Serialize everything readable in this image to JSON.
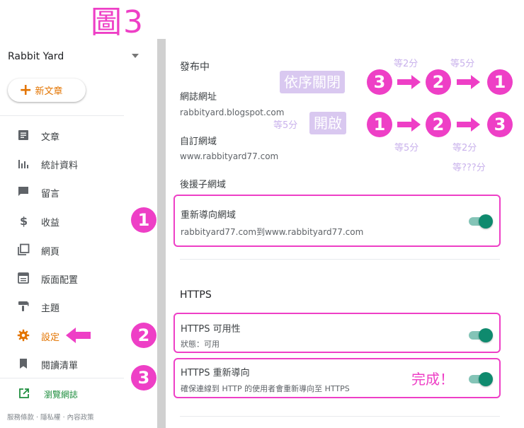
{
  "figure_title": "圖3",
  "sidebar": {
    "blog_name": "Rabbit Yard",
    "new_post_label": "新文章",
    "items": [
      {
        "label": "文章",
        "icon": "post-icon"
      },
      {
        "label": "統計資料",
        "icon": "stats-icon"
      },
      {
        "label": "留言",
        "icon": "comment-icon"
      },
      {
        "label": "收益",
        "icon": "dollar-icon"
      },
      {
        "label": "網頁",
        "icon": "pages-icon"
      },
      {
        "label": "版面配置",
        "icon": "layout-icon"
      },
      {
        "label": "主題",
        "icon": "theme-icon"
      },
      {
        "label": "設定",
        "icon": "gear-icon"
      },
      {
        "label": "閱讀清單",
        "icon": "bookmark-icon"
      }
    ],
    "view_blog_label": "瀏覽網誌",
    "footer_links": "服務條款 · 隱私權 · 內容政策"
  },
  "main": {
    "publishing_heading": "發布中",
    "blog_address_label": "網誌網址",
    "blog_address_value": "rabbityard.blogspot.com",
    "custom_domain_label": "自訂網域",
    "custom_domain_value": "www.rabbityard77.com",
    "fallback_domain_label": "後援子網域",
    "redirect_domain": {
      "label": "重新導向網域",
      "value": "rabbityard77.com到www.rabbityard77.com"
    },
    "https_heading": "HTTPS",
    "https_availability": {
      "label": "HTTPS 可用性",
      "value": "狀態：可用"
    },
    "https_redirect": {
      "label": "HTTPS 重新導向",
      "value": "確保連線到 HTTP 的使用者會重新導向至 HTTPS"
    }
  },
  "annotations": {
    "close_order_label": "依序關閉",
    "open_label": "開啟",
    "steps": [
      "1",
      "2",
      "3"
    ],
    "wait_2min": "等2分",
    "wait_5min": "等5分",
    "wait_unknown": "等???分",
    "done_label": "完成！"
  },
  "colors": {
    "accent_pink": "#ee3fc6",
    "active_orange": "#e37400",
    "toggle_green": "#0f8a6e",
    "pill_purple": "#d9c8f0"
  }
}
